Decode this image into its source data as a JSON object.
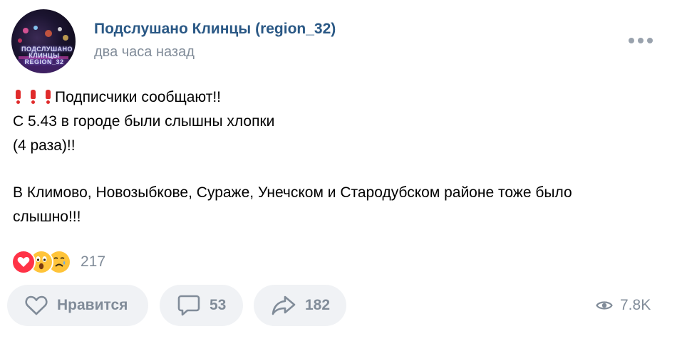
{
  "post": {
    "author": "Подслушано Клинцы (region_32)",
    "time": "два часа назад",
    "avatar_logo_lines": [
      "ПОДСЛУШАНО",
      "КЛИНЦЫ",
      "REGION_32"
    ],
    "text": {
      "line1": "Подписчики сообщают!!",
      "line2": "С 5.43 в городе были слышны хлопки",
      "line3": "(4 раза)!!",
      "line4": "В Климово, Новозыбкове, Сураже, Унечском и Стародубском районе тоже было",
      "line5": "слышно!!!"
    }
  },
  "reactions": {
    "icons": [
      "heart-reaction-icon",
      "wow-reaction-icon",
      "sad-reaction-icon"
    ],
    "count": "217"
  },
  "actions": {
    "like_label": "Нравится",
    "comments_count": "53",
    "shares_count": "182",
    "views_count": "7.8K"
  },
  "colors": {
    "author": "#2a5885",
    "muted": "#818c99",
    "button_bg": "#f0f2f5",
    "exclamation": "#e02b2b"
  }
}
